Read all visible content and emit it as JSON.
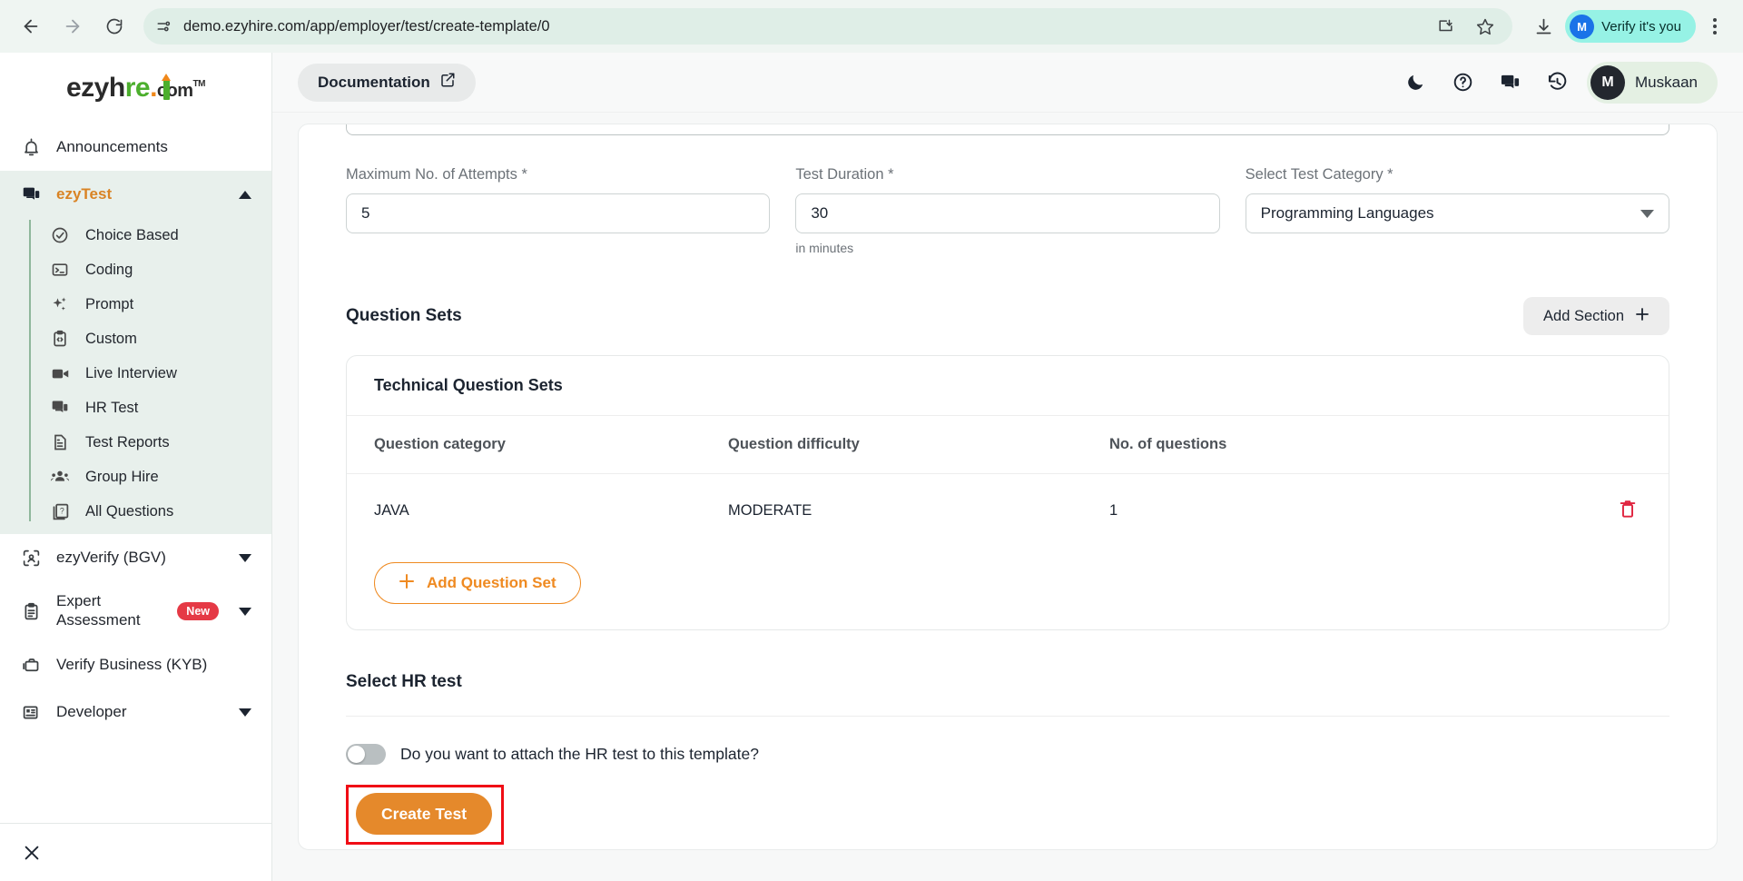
{
  "browser": {
    "url": "demo.ezyhire.com/app/employer/test/create-template/0",
    "back_icon": "back-arrow-icon",
    "forward_icon": "forward-arrow-icon",
    "reload_icon": "reload-icon",
    "site_info_icon": "site-settings-icon",
    "install_icon": "install-app-icon",
    "bookmark_icon": "star-icon",
    "download_icon": "download-icon",
    "verify_label": "Verify it's you",
    "verify_avatar_initial": "M",
    "menu_icon": "kebab-menu-icon"
  },
  "sidebar": {
    "logo": {
      "part1": "ezyh",
      "part2": "re",
      "dot": ".",
      "com": "com",
      "tm": "TM"
    },
    "announcements": {
      "label": "Announcements",
      "icon": "bell-icon"
    },
    "group": {
      "label": "ezyTest",
      "icon": "chat-icon",
      "caret": "caret-up-icon"
    },
    "sub_items": [
      {
        "label": "Choice Based",
        "icon": "check-circle-icon"
      },
      {
        "label": "Coding",
        "icon": "terminal-icon"
      },
      {
        "label": "Prompt",
        "icon": "sparkle-icon"
      },
      {
        "label": "Custom",
        "icon": "clipboard-code-icon"
      },
      {
        "label": "Live Interview",
        "icon": "video-camera-icon"
      },
      {
        "label": "HR Test",
        "icon": "chat-icon"
      },
      {
        "label": "Test Reports",
        "icon": "document-icon"
      },
      {
        "label": "Group Hire",
        "icon": "group-people-icon"
      },
      {
        "label": "All Questions",
        "icon": "question-stack-icon"
      }
    ],
    "items": [
      {
        "label": "ezyVerify (BGV)",
        "icon": "face-scan-icon",
        "caret": "caret-down-icon",
        "badge": ""
      },
      {
        "label": "Expert Assessment",
        "icon": "clipboard-icon",
        "caret": "caret-down-icon",
        "badge": "New"
      },
      {
        "label": "Verify Business (KYB)",
        "icon": "briefcase-icon",
        "caret": "",
        "badge": ""
      },
      {
        "label": "Developer",
        "icon": "dashboard-icon",
        "caret": "caret-down-icon",
        "badge": ""
      }
    ],
    "close_icon": "close-icon"
  },
  "topbar": {
    "documentation_label": "Documentation",
    "documentation_icon": "external-link-icon",
    "dark_mode_icon": "moon-icon",
    "help_icon": "help-circle-icon",
    "chat_icon": "chat-icon",
    "history_icon": "history-icon",
    "user_name": "Muskaan",
    "user_initial": "M"
  },
  "form": {
    "attempts": {
      "label": "Maximum No. of Attempts *",
      "value": "5"
    },
    "duration": {
      "label": "Test Duration *",
      "value": "30",
      "hint": "in minutes"
    },
    "category": {
      "label": "Select Test Category *",
      "value": "Programming Languages",
      "caret": "chevron-down-icon"
    }
  },
  "question_sets": {
    "title": "Question Sets",
    "add_section_label": "Add Section",
    "add_section_icon": "plus-icon",
    "panel_title": "Technical Question Sets",
    "columns": [
      "Question category",
      "Question difficulty",
      "No. of questions"
    ],
    "rows": [
      {
        "category": "JAVA",
        "difficulty": "MODERATE",
        "count": "1",
        "delete_icon": "trash-icon"
      }
    ],
    "add_question_set_label": "Add Question Set",
    "add_question_set_icon": "plus-icon"
  },
  "hr_test": {
    "title": "Select HR test",
    "toggle_label": "Do you want to attach the HR test to this template?",
    "toggle_state": "off"
  },
  "submit": {
    "create_label": "Create Test",
    "highlight_color": "#f00d15",
    "button_color": "#e5892b"
  }
}
